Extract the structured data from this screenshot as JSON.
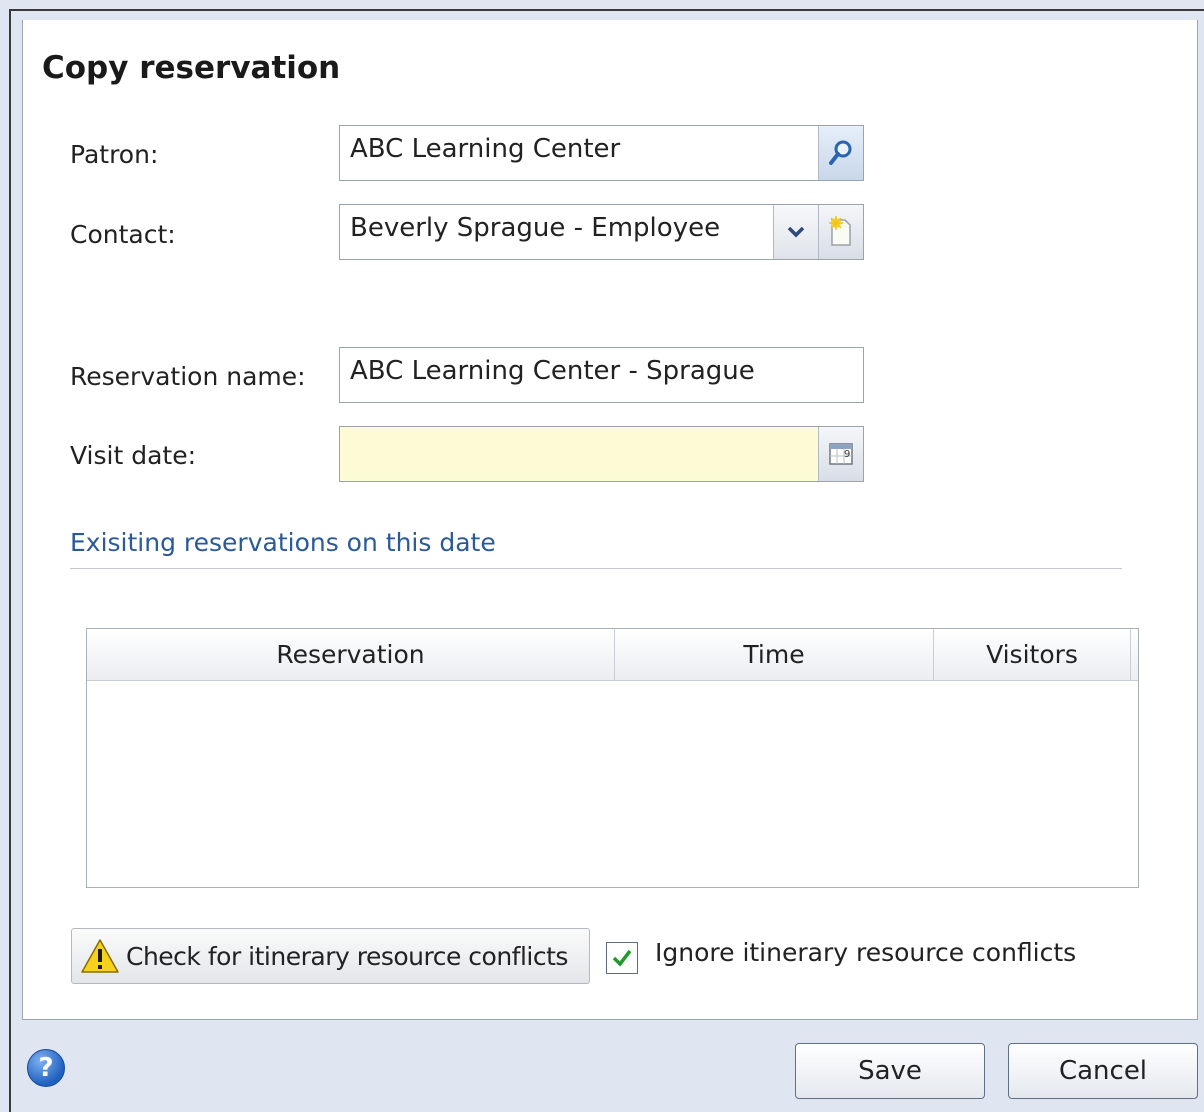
{
  "dialog": {
    "title": "Copy reservation"
  },
  "fields": {
    "patron": {
      "label": "Patron:",
      "value": "ABC Learning Center"
    },
    "contact": {
      "label": "Contact:",
      "value": "Beverly Sprague - Employee"
    },
    "reservation_name": {
      "label": "Reservation name:",
      "value": "ABC Learning Center - Sprague"
    },
    "visit_date": {
      "label": "Visit date:",
      "value": ""
    }
  },
  "existing": {
    "heading": "Exisiting reservations on this date",
    "columns": [
      "Reservation",
      "Time",
      "Visitors"
    ],
    "rows": []
  },
  "conflicts": {
    "check_label": "Check for itinerary resource conflicts",
    "ignore_label": "Ignore itinerary resource conflicts",
    "ignore_checked": true
  },
  "footer": {
    "save_label": "Save",
    "cancel_label": "Cancel"
  },
  "colors": {
    "visit_date_bg": "#fdfbd5",
    "link": "#2a5a98"
  }
}
